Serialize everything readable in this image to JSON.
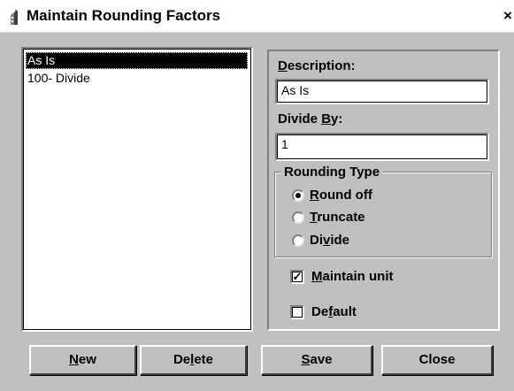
{
  "window": {
    "title": "Maintain Rounding Factors",
    "close_glyph": "×"
  },
  "list": {
    "items": [
      "As Is",
      "100- Divide"
    ],
    "selected_index": 0
  },
  "form": {
    "description_label": {
      "before": "",
      "key": "D",
      "after": "escription:"
    },
    "description_value": "As Is",
    "divide_by_label": {
      "before": "Divide ",
      "key": "B",
      "after": "y:"
    },
    "divide_by_value": "1",
    "rounding_type_label": "Rounding Type",
    "rounding_options": [
      {
        "before": "",
        "key": "R",
        "after": "ound off",
        "selected": true
      },
      {
        "before": "",
        "key": "T",
        "after": "runcate",
        "selected": false
      },
      {
        "before": "Di",
        "key": "v",
        "after": "ide",
        "selected": false
      }
    ],
    "maintain_unit": {
      "before": "",
      "key": "M",
      "after": "aintain unit",
      "checked": true
    },
    "default": {
      "before": "De",
      "key": "f",
      "after": "ault",
      "checked": false
    }
  },
  "buttons": {
    "new": {
      "before": "",
      "key": "N",
      "after": "ew"
    },
    "delete": {
      "before": "De",
      "key": "l",
      "after": "ete"
    },
    "save": {
      "before": "",
      "key": "S",
      "after": "ave"
    },
    "close": "Close"
  },
  "icons": {
    "title_icon": "app-building-icon",
    "check_glyph": "✓",
    "close_glyph_name": "close-icon"
  }
}
